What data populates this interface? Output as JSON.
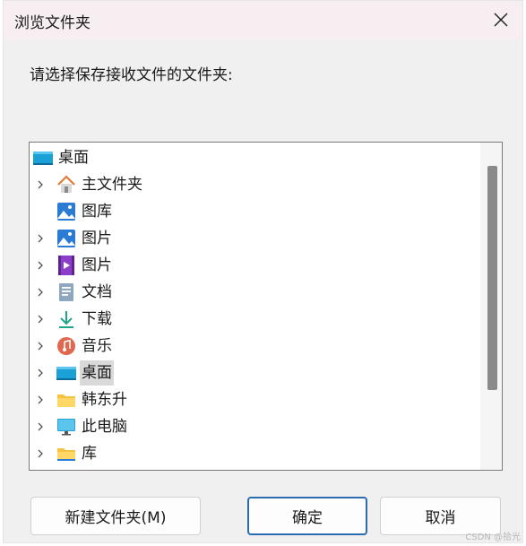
{
  "window": {
    "title": "浏览文件夹"
  },
  "prompt": "请选择保存接收文件的文件夹:",
  "tree": {
    "root": {
      "label": "桌面",
      "icon": "desktop-icon"
    },
    "items": [
      {
        "label": "主文件夹",
        "icon": "home-icon",
        "expandable": true,
        "selected": false
      },
      {
        "label": "图库",
        "icon": "gallery-icon",
        "expandable": false,
        "selected": false
      },
      {
        "label": "图片",
        "icon": "pictures-icon",
        "expandable": true,
        "selected": false
      },
      {
        "label": "图片",
        "icon": "video-icon",
        "expandable": true,
        "selected": false
      },
      {
        "label": "文档",
        "icon": "documents-icon",
        "expandable": true,
        "selected": false
      },
      {
        "label": "下载",
        "icon": "downloads-icon",
        "expandable": true,
        "selected": false
      },
      {
        "label": "音乐",
        "icon": "music-icon",
        "expandable": true,
        "selected": false
      },
      {
        "label": "桌面",
        "icon": "desktop-icon",
        "expandable": true,
        "selected": true
      },
      {
        "label": "韩东升",
        "icon": "folder-icon",
        "expandable": true,
        "selected": false
      },
      {
        "label": "此电脑",
        "icon": "computer-icon",
        "expandable": true,
        "selected": false
      },
      {
        "label": "库",
        "icon": "library-icon",
        "expandable": true,
        "selected": false
      }
    ]
  },
  "buttons": {
    "new_folder": "新建文件夹(M)",
    "ok": "确定",
    "cancel": "取消"
  },
  "watermark": "CSDN @拾光",
  "colors": {
    "accent": "#2b6cb0",
    "selection": "#d9d9d9",
    "titlebar": "#f7eef2"
  }
}
